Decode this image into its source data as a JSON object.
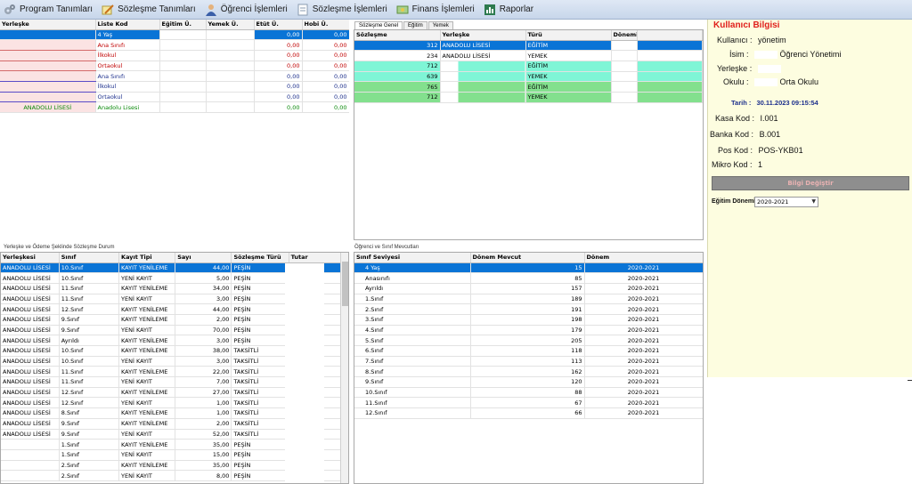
{
  "menu": [
    {
      "label": "Program Tanımları",
      "icon": "gears-icon"
    },
    {
      "label": "Sözleşme Tanımları",
      "icon": "pencil-paper-icon"
    },
    {
      "label": "Öğrenci İşlemleri",
      "icon": "user-icon"
    },
    {
      "label": "Sözleşme İşlemleri",
      "icon": "document-icon"
    },
    {
      "label": "Finans İşlemleri",
      "icon": "money-icon"
    },
    {
      "label": "Raporlar",
      "icon": "report-icon"
    }
  ],
  "fee_grid": {
    "headers": [
      "Yerleşke",
      "Liste Kod",
      "Eğitim Ü.",
      "Yemek Ü.",
      "Etüt Ü.",
      "Hobi Ü."
    ],
    "rows": [
      {
        "yerleske": "",
        "kod": "4 Yaş",
        "egitim": "",
        "yemek": "",
        "etut": "0,00",
        "hobi": "0,00",
        "style": "sel"
      },
      {
        "yerleske": "",
        "kod": "Ana Sınıfı",
        "egitim": "",
        "yemek": "",
        "etut": "0,00",
        "hobi": "0,00",
        "style": "red"
      },
      {
        "yerleske": "",
        "kod": "İlkokul",
        "egitim": "",
        "yemek": "",
        "etut": "0,00",
        "hobi": "0,00",
        "style": "red"
      },
      {
        "yerleske": "",
        "kod": "Ortaokul",
        "egitim": "",
        "yemek": "",
        "etut": "0,00",
        "hobi": "0,00",
        "style": "red"
      },
      {
        "yerleske": "",
        "kod": "Ana Sınıfı",
        "egitim": "",
        "yemek": "",
        "etut": "0,00",
        "hobi": "0,00",
        "style": "blue"
      },
      {
        "yerleske": "",
        "kod": "İlkokul",
        "egitim": "",
        "yemek": "",
        "etut": "0,00",
        "hobi": "0,00",
        "style": "blue"
      },
      {
        "yerleske": "",
        "kod": "Ortaokul",
        "egitim": "",
        "yemek": "",
        "etut": "0,00",
        "hobi": "0,00",
        "style": "blue"
      },
      {
        "yerleske": "ANADOLU LİSESİ",
        "kod": "Anadolu Lisesi",
        "egitim": "",
        "yemek": "",
        "etut": "0,00",
        "hobi": "0,00",
        "style": "green"
      }
    ]
  },
  "contract_tabs": [
    "Sözleşme Genel",
    "Eğitim",
    "Yemek"
  ],
  "contract_grid": {
    "headers": [
      "Sözleşme",
      "Yerleşke",
      "Türü",
      "Dönemi"
    ],
    "rows": [
      {
        "no": "312",
        "yerleske": "ANADOLU LİSESİ",
        "turu": "EĞİTİM",
        "donem": "",
        "style": "sel"
      },
      {
        "no": "234",
        "yerleske": "ANADOLU LİSESİ",
        "turu": "YEMEK",
        "donem": "",
        "style": "white"
      },
      {
        "no": "712",
        "yerleske": "",
        "turu": "EĞİTİM",
        "donem": "",
        "style": "mint"
      },
      {
        "no": "639",
        "yerleske": "",
        "turu": "YEMEK",
        "donem": "",
        "style": "mint"
      },
      {
        "no": "765",
        "yerleske": "",
        "turu": "EĞİTİM",
        "donem": "",
        "style": "lime"
      },
      {
        "no": "712",
        "yerleske": "",
        "turu": "YEMEK",
        "donem": "",
        "style": "lime"
      }
    ]
  },
  "user_info": {
    "title": "Kullanıcı Bilgisi",
    "kullanici_label": "Kullanıcı :",
    "kullanici": "yönetim",
    "isim_label": "İsim :",
    "isim": "Öğrenci Yönetimi",
    "yerleske_label": "Yerleşke :",
    "yerleske": "",
    "okulu_label": "Okulu :",
    "okulu": "Orta Okulu",
    "tarih_label": "Tarih :",
    "tarih": "30.11.2023 09:15:54",
    "kasa_label": "Kasa Kod :",
    "kasa": "I.001",
    "banka_label": "Banka Kod :",
    "banka": "B.001",
    "pos_label": "Pos Kod :",
    "pos": "POS-YKB01",
    "mikro_label": "Mikro Kod :",
    "mikro": "1",
    "button": "Bilgi Değiştir",
    "donem_label": "Eğitim Dönemi",
    "donem_value": "2020-2021"
  },
  "section_labels": {
    "left_bottom": "Yerleşke ve Ödeme Şeklinde Sözleşme Durum",
    "mid_bottom": "Öğrenci ve Sınıf Mevcutları"
  },
  "payment_grid": {
    "headers": [
      "Yerleşkesi",
      "Sınıf",
      "Kayıt Tipi",
      "Sayı",
      "Sözleşme Türü",
      "Tutar"
    ],
    "rows": [
      {
        "yer": "ANADOLU LİSESİ",
        "sinif": "10.Sınıf",
        "tip": "KAYIT YENİLEME",
        "sayi": "44,00",
        "tur": "PEŞİN",
        "sel": true
      },
      {
        "yer": "ANADOLU LİSESİ",
        "sinif": "10.Sınıf",
        "tip": "YENİ KAYIT",
        "sayi": "5,00",
        "tur": "PEŞİN"
      },
      {
        "yer": "ANADOLU LİSESİ",
        "sinif": "11.Sınıf",
        "tip": "KAYIT YENİLEME",
        "sayi": "34,00",
        "tur": "PEŞİN"
      },
      {
        "yer": "ANADOLU LİSESİ",
        "sinif": "11.Sınıf",
        "tip": "YENİ KAYIT",
        "sayi": "3,00",
        "tur": "PEŞİN"
      },
      {
        "yer": "ANADOLU LİSESİ",
        "sinif": "12.Sınıf",
        "tip": "KAYIT YENİLEME",
        "sayi": "44,00",
        "tur": "PEŞİN"
      },
      {
        "yer": "ANADOLU LİSESİ",
        "sinif": "9.Sınıf",
        "tip": "KAYIT YENİLEME",
        "sayi": "2,00",
        "tur": "PEŞİN"
      },
      {
        "yer": "ANADOLU LİSESİ",
        "sinif": "9.Sınıf",
        "tip": "YENİ KAYIT",
        "sayi": "70,00",
        "tur": "PEŞİN"
      },
      {
        "yer": "ANADOLU LİSESİ",
        "sinif": "Ayrıldı",
        "tip": "KAYIT YENİLEME",
        "sayi": "3,00",
        "tur": "PEŞİN"
      },
      {
        "yer": "ANADOLU LİSESİ",
        "sinif": "10.Sınıf",
        "tip": "KAYIT YENİLEME",
        "sayi": "38,00",
        "tur": "TAKSİTLİ"
      },
      {
        "yer": "ANADOLU LİSESİ",
        "sinif": "10.Sınıf",
        "tip": "YENİ KAYIT",
        "sayi": "3,00",
        "tur": "TAKSİTLİ"
      },
      {
        "yer": "ANADOLU LİSESİ",
        "sinif": "11.Sınıf",
        "tip": "KAYIT YENİLEME",
        "sayi": "22,00",
        "tur": "TAKSİTLİ"
      },
      {
        "yer": "ANADOLU LİSESİ",
        "sinif": "11.Sınıf",
        "tip": "YENİ KAYIT",
        "sayi": "7,00",
        "tur": "TAKSİTLİ"
      },
      {
        "yer": "ANADOLU LİSESİ",
        "sinif": "12.Sınıf",
        "tip": "KAYIT YENİLEME",
        "sayi": "27,00",
        "tur": "TAKSİTLİ"
      },
      {
        "yer": "ANADOLU LİSESİ",
        "sinif": "12.Sınıf",
        "tip": "YENİ KAYIT",
        "sayi": "1,00",
        "tur": "TAKSİTLİ"
      },
      {
        "yer": "ANADOLU LİSESİ",
        "sinif": "8.Sınıf",
        "tip": "KAYIT YENİLEME",
        "sayi": "1,00",
        "tur": "TAKSİTLİ"
      },
      {
        "yer": "ANADOLU LİSESİ",
        "sinif": "9.Sınıf",
        "tip": "KAYIT YENİLEME",
        "sayi": "2,00",
        "tur": "TAKSİTLİ"
      },
      {
        "yer": "ANADOLU LİSESİ",
        "sinif": "9.Sınıf",
        "tip": "YENİ KAYIT",
        "sayi": "52,00",
        "tur": "TAKSİTLİ"
      },
      {
        "yer": "",
        "sinif": "1.Sınıf",
        "tip": "KAYIT YENİLEME",
        "sayi": "35,00",
        "tur": "PEŞİN"
      },
      {
        "yer": "",
        "sinif": "1.Sınıf",
        "tip": "YENİ KAYIT",
        "sayi": "15,00",
        "tur": "PEŞİN"
      },
      {
        "yer": "",
        "sinif": "2.Sınıf",
        "tip": "KAYIT YENİLEME",
        "sayi": "35,00",
        "tur": "PEŞİN"
      },
      {
        "yer": "",
        "sinif": "2.Sınıf",
        "tip": "YENİ KAYIT",
        "sayi": "8,00",
        "tur": "PEŞİN"
      }
    ]
  },
  "class_grid": {
    "headers": [
      "Sınıf Seviyesi",
      "Dönem Mevcut",
      "Dönem"
    ],
    "rows": [
      {
        "seviye": "4 Yaş",
        "mevcut": "15",
        "donem": "2020-2021",
        "sel": true
      },
      {
        "seviye": "Anasınıfı",
        "mevcut": "85",
        "donem": "2020-2021"
      },
      {
        "seviye": "Ayrıldı",
        "mevcut": "157",
        "donem": "2020-2021"
      },
      {
        "seviye": "1.Sınıf",
        "mevcut": "189",
        "donem": "2020-2021"
      },
      {
        "seviye": "2.Sınıf",
        "mevcut": "191",
        "donem": "2020-2021"
      },
      {
        "seviye": "3.Sınıf",
        "mevcut": "198",
        "donem": "2020-2021"
      },
      {
        "seviye": "4.Sınıf",
        "mevcut": "179",
        "donem": "2020-2021"
      },
      {
        "seviye": "5.Sınıf",
        "mevcut": "205",
        "donem": "2020-2021"
      },
      {
        "seviye": "6.Sınıf",
        "mevcut": "118",
        "donem": "2020-2021"
      },
      {
        "seviye": "7.Sınıf",
        "mevcut": "113",
        "donem": "2020-2021"
      },
      {
        "seviye": "8.Sınıf",
        "mevcut": "162",
        "donem": "2020-2021"
      },
      {
        "seviye": "9.Sınıf",
        "mevcut": "120",
        "donem": "2020-2021"
      },
      {
        "seviye": "10.Sınıf",
        "mevcut": "88",
        "donem": "2020-2021"
      },
      {
        "seviye": "11.Sınıf",
        "mevcut": "67",
        "donem": "2020-2021"
      },
      {
        "seviye": "12.Sınıf",
        "mevcut": "66",
        "donem": "2020-2021"
      }
    ]
  },
  "colors": {
    "selection": "#0a74d6",
    "mint": "#7ff5d6",
    "lime": "#83e08e",
    "panel": "#fdfde0",
    "title_red": "#e0201c"
  }
}
